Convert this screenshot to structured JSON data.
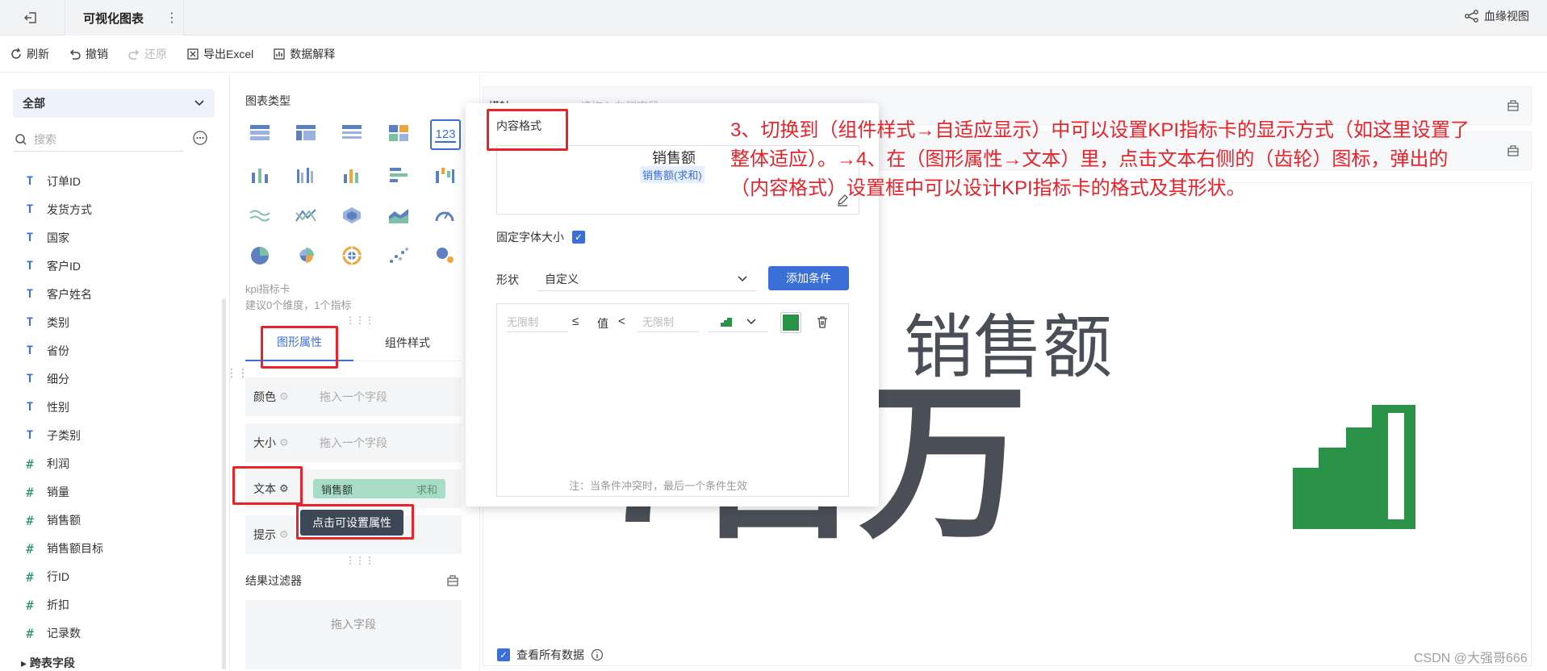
{
  "header": {
    "title": "可视化图表",
    "more": "⋮",
    "lineage": "血缘视图"
  },
  "toolbar": {
    "refresh": "刷新",
    "undo": "撤销",
    "redo": "还原",
    "export": "导出Excel",
    "explain": "数据解释"
  },
  "sidebar": {
    "scope": "全部",
    "search_placeholder": "搜索",
    "fields": [
      {
        "label": "订单ID",
        "type": "T"
      },
      {
        "label": "发货方式",
        "type": "T"
      },
      {
        "label": "国家",
        "type": "T"
      },
      {
        "label": "客户ID",
        "type": "T"
      },
      {
        "label": "客户姓名",
        "type": "T"
      },
      {
        "label": "类别",
        "type": "T"
      },
      {
        "label": "省份",
        "type": "T"
      },
      {
        "label": "细分",
        "type": "T"
      },
      {
        "label": "性别",
        "type": "T"
      },
      {
        "label": "子类别",
        "type": "T"
      },
      {
        "label": "利润",
        "type": "#"
      },
      {
        "label": "销量",
        "type": "#"
      },
      {
        "label": "销售额",
        "type": "#"
      },
      {
        "label": "销售额目标",
        "type": "#"
      },
      {
        "label": "行ID",
        "type": "#"
      },
      {
        "label": "折扣",
        "type": "#"
      },
      {
        "label": "记录数",
        "type": "#"
      }
    ],
    "cross_fields": "跨表字段"
  },
  "chart_panel": {
    "chart_type_label": "图表类型",
    "selected_type_glyph": "123",
    "kpi_name": "kpi指标卡",
    "kpi_hint": "建议0个维度，1个指标",
    "tab_graph": "图形属性",
    "tab_component": "组件样式",
    "props": {
      "color_label": "颜色",
      "size_label": "大小",
      "text_label": "文本",
      "tip_label": "提示",
      "drop_placeholder": "拖入一个字段"
    },
    "text_field": {
      "name": "销售额",
      "agg": "求和"
    },
    "tooltip": "点击可设置属性",
    "result_filter": "结果过滤器",
    "drop_field": "拖入字段"
  },
  "canvas": {
    "kpi_title": "销售额",
    "kpi_value_visible": "7百万",
    "see_all": "查看所有数据",
    "row1_label": "横轴",
    "row1_placeholder": "请拖入左侧字段"
  },
  "popup": {
    "title": "内容格式",
    "preview_title": "销售额",
    "preview_sub": "销售额(求和)",
    "fixed_font_label": "固定字体大小",
    "shape_label": "形状",
    "shape_value": "自定义",
    "add_condition": "添加条件",
    "cond_unlimited": "无限制",
    "cond_le": "≤",
    "cond_value": "值",
    "cond_lt": "<",
    "note": "注：当条件冲突时，最后一个条件生效"
  },
  "annotation": {
    "text": "3、切换到（组件样式→自适应显示）中可以设置KPI指标卡的显示方式（如这里设置了整体适应）。→4、在（图形属性→文本）里，点击文本右侧的（齿轮）图标，弹出的（内容格式）设置框中可以设计KPI指标卡的格式及其形状。"
  },
  "watermark": "CSDN @大强哥666",
  "colors": {
    "accent": "#3a6fd8",
    "annotation": "#e8232a",
    "kpi_green": "#2b9348",
    "pill": "#a8dcc6"
  }
}
